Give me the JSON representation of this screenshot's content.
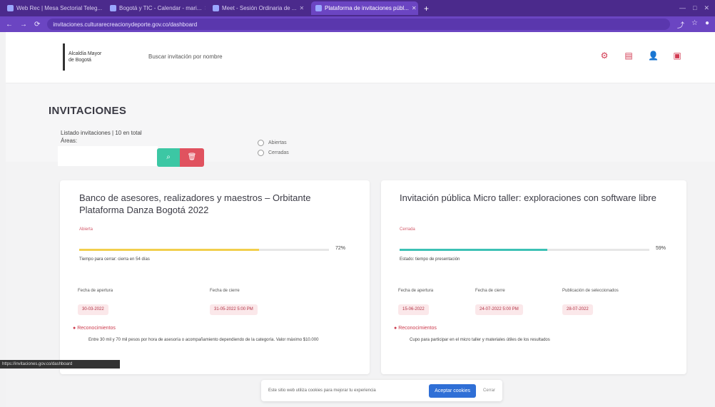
{
  "browser": {
    "tabs": [
      {
        "title": "Web Rec | Mesa Sectorial Teleg..."
      },
      {
        "title": "Bogotá y TIC - Calendar - mari..."
      },
      {
        "title": "Meet - Sesión Ordinaria de ..."
      },
      {
        "title": "Plataforma de invitaciones públ..."
      }
    ],
    "url": "invitaciones.culturarecreacionydeporte.gov.co/dashboard"
  },
  "header": {
    "logo_line1": "Alcaldía Mayor",
    "logo_line2": "de Bogotá",
    "search_placeholder": "Buscar invitación por nombre"
  },
  "page": {
    "title": "INVITACIONES",
    "summary": "Listado invitaciones | 10 en total",
    "areas_label": "Áreas:",
    "filters": [
      {
        "label": "Abiertas"
      },
      {
        "label": "Cerradas"
      }
    ]
  },
  "cards": [
    {
      "title": "Banco de asesores, realizadores y maestros – Orbitante Plataforma Danza Bogotá 2022",
      "status": "Abierta",
      "progress": 0.72,
      "progress_color": "#f2cf4d",
      "pct": "72%",
      "sub": "Tiempo para cerrar: cierra en 54 días",
      "fields": [
        {
          "label": "Fecha de apertura",
          "value": "30-03-2022"
        },
        {
          "label": "Fecha de cierre",
          "value": "31-05-2022 5:00 PM"
        }
      ],
      "reco_title": "Reconocimientos",
      "reco_text": "Entre 30 mil y 70 mil pesos por hora de asesoría o acompañamiento dependiendo de la categoría. Valor máximo $10.000"
    },
    {
      "title": "Invitación pública Micro taller: exploraciones con software libre",
      "status": "Cerrada",
      "progress": 0.59,
      "progress_color": "#3dc1b5",
      "pct": "59%",
      "sub": "Estado: tiempo de presentación",
      "fields": [
        {
          "label": "Fecha de apertura",
          "value": "15-06-2022"
        },
        {
          "label": "Fecha de cierre",
          "value": "24-07-2022 5:00 PM"
        },
        {
          "label": "Publicación de seleccionados",
          "value": "28-07-2022"
        }
      ],
      "reco_title": "Reconocimientos",
      "reco_text": "Cupo para participar en el micro taller y materiales útiles de los resultados"
    }
  ],
  "cookie": {
    "text": "Este sitio web utiliza cookies para mejorar tu experiencia",
    "accept": "Aceptar cookies",
    "close": "Cerrar"
  },
  "statusbar": "https://invitaciones.gov.co/dashboard",
  "colors": {
    "browser_bar": "#4b2a8c",
    "accent_red": "#e0525f",
    "accent_green": "#3cc7a4"
  }
}
